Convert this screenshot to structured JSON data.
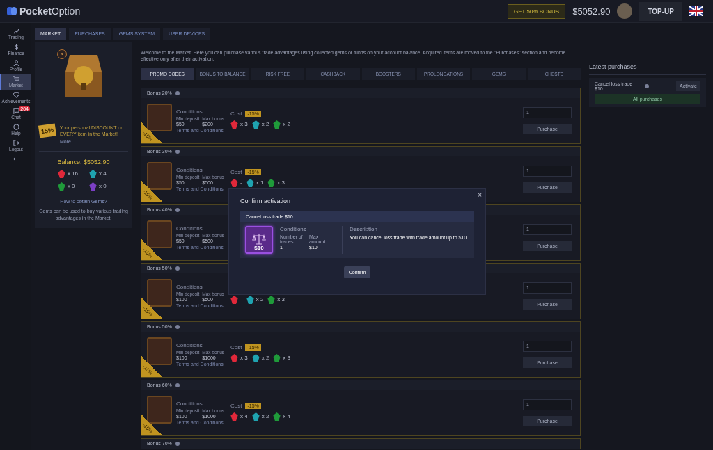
{
  "header": {
    "logo": {
      "strong": "Pocket",
      "light": "Option"
    },
    "bonus_button": "GET 50% BONUS",
    "balance": "$5052.90",
    "topup_button": "TOP-UP"
  },
  "sidebar": {
    "items": [
      {
        "kind": "chart",
        "label": "Trading",
        "selected": false
      },
      {
        "kind": "dollar",
        "label": "Finance",
        "selected": false
      },
      {
        "kind": "user",
        "label": "Profile",
        "selected": false
      },
      {
        "kind": "cart",
        "label": "Market",
        "selected": true
      },
      {
        "kind": "diamond",
        "label": "Achievements",
        "selected": false
      },
      {
        "kind": "chat",
        "label": "Chat",
        "selected": false,
        "badge": "204"
      },
      {
        "kind": "help",
        "label": "Help",
        "selected": false
      },
      {
        "kind": "logout",
        "label": "Logout",
        "selected": false
      },
      {
        "kind": "collapse",
        "selected": false
      }
    ]
  },
  "tabs": [
    {
      "label": "MARKET",
      "selected": true
    },
    {
      "label": "PURCHASES",
      "selected": false
    },
    {
      "label": "GEMS SYSTEM",
      "selected": false
    },
    {
      "label": "USER DEVICES",
      "selected": false
    }
  ],
  "left_panel": {
    "chest_level": "3",
    "discount_badge": "15%",
    "discount_text": "Your personal DISCOUNT on EVERY item in the Market!",
    "more_link": "More",
    "balance": "Balance: $5052.90",
    "gems": [
      {
        "color": "#e0283a",
        "count": "x 16"
      },
      {
        "color": "#1fa3b0",
        "count": "x 4"
      },
      {
        "color": "#1f9a3a",
        "count": "x 0"
      },
      {
        "color": "#7b3fc4",
        "count": "x 0"
      }
    ],
    "gems_link": "How to obtain Gems?",
    "gems_note": "Gems can be used to buy various trading advantages in the Market."
  },
  "intro": "Welcome to the Market! Here you can purchase various trade advantages using collected gems or funds on your account balance. Acquired items are moved to the \"Purchases\" section and become effective only after their activation.",
  "categories": [
    {
      "label": "PROMO CODES",
      "selected": true
    },
    {
      "label": "BONUS TO BALANCE",
      "selected": false
    },
    {
      "label": "RISK FREE",
      "selected": false
    },
    {
      "label": "CASHBACK",
      "selected": false
    },
    {
      "label": "BOOSTERS",
      "selected": false
    },
    {
      "label": "PROLONGATIONS",
      "selected": false
    },
    {
      "label": "GEMS",
      "selected": false
    },
    {
      "label": "CHESTS",
      "selected": false
    }
  ],
  "offers": [
    {
      "title": "Bonus 20%",
      "ribbon": "-15%",
      "conditions": "Conditions",
      "min_label": "Min deposit",
      "min": "$50",
      "max_label": "Max bonus",
      "max": "$200",
      "terms": "Terms and Conditions",
      "cost_label": "Cost",
      "cost_badge": "-15%",
      "costs": [
        {
          "color": "#e0283a",
          "count": "x 3"
        },
        {
          "color": "#1fa3b0",
          "count": "x 2"
        },
        {
          "color": "#1f9a3a",
          "count": "x 2"
        }
      ],
      "quantity": "1",
      "purchase": "Purchase"
    },
    {
      "title": "Bonus 30%",
      "ribbon": "-15%",
      "conditions": "Conditions",
      "min_label": "Min deposit",
      "min": "$50",
      "max_label": "Max bonus",
      "max": "$500",
      "terms": "Terms and Conditions",
      "cost_label": "Cost",
      "cost_badge": "-15%",
      "costs": [
        {
          "color": "#e0283a",
          "count": "-"
        },
        {
          "color": "#1fa3b0",
          "count": "x 1"
        },
        {
          "color": "#1f9a3a",
          "count": "x 3"
        }
      ],
      "quantity": "1",
      "purchase": "Purchase"
    },
    {
      "title": "Bonus 40%",
      "ribbon": "-15%",
      "conditions": "Conditions",
      "min_label": "Min deposit",
      "min": "$50",
      "max_label": "Max bonus",
      "max": "$500",
      "terms": "Terms and Conditions",
      "quantity": "1",
      "purchase": "Purchase"
    },
    {
      "title": "Bonus 50%",
      "ribbon": "-15%",
      "conditions": "Conditions",
      "min_label": "Min deposit",
      "min": "$100",
      "max_label": "Max bonus",
      "max": "$500",
      "terms": "Terms and Conditions",
      "costs": [
        {
          "color": "#e0283a",
          "count": "-"
        },
        {
          "color": "#1fa3b0",
          "count": "x 2"
        },
        {
          "color": "#1f9a3a",
          "count": "x 3"
        }
      ],
      "quantity": "1",
      "purchase": "Purchase"
    },
    {
      "title": "Bonus 50%",
      "ribbon": "-15%",
      "conditions": "Conditions",
      "min_label": "Min deposit",
      "min": "$100",
      "max_label": "Max bonus",
      "max": "$1000",
      "terms": "Terms and Conditions",
      "cost_label": "Cost",
      "cost_badge": "-15%",
      "costs": [
        {
          "color": "#e0283a",
          "count": "x 3"
        },
        {
          "color": "#1fa3b0",
          "count": "x 2"
        },
        {
          "color": "#1f9a3a",
          "count": "x 3"
        }
      ],
      "quantity": "1",
      "purchase": "Purchase"
    },
    {
      "title": "Bonus 60%",
      "ribbon": "-15%",
      "conditions": "Conditions",
      "min_label": "Min deposit",
      "min": "$100",
      "max_label": "Max bonus",
      "max": "$1000",
      "terms": "Terms and Conditions",
      "cost_label": "Cost",
      "cost_badge": "-15%",
      "costs": [
        {
          "color": "#e0283a",
          "count": "x 4"
        },
        {
          "color": "#1fa3b0",
          "count": "x 2"
        },
        {
          "color": "#1f9a3a",
          "count": "x 4"
        }
      ],
      "quantity": "1",
      "purchase": "Purchase"
    },
    {
      "title": "Bonus 70%"
    }
  ],
  "latest": {
    "title": "Latest purchases",
    "items": [
      {
        "name": "Cancel loss trade $10",
        "action": "Activate"
      }
    ],
    "all_button": "All purchases"
  },
  "modal": {
    "title": "Confirm activation",
    "close": "×",
    "item_title": "Cancel loss trade $10",
    "item_price": "$10",
    "conditions_title": "Conditions",
    "conditions": [
      {
        "label": "Number of trades:",
        "value": "1"
      },
      {
        "label": "Max amount:",
        "value": "$10"
      }
    ],
    "description_title": "Description",
    "description": "You can cancel loss trade with trade amount up to $10",
    "confirm": "Confirm"
  }
}
